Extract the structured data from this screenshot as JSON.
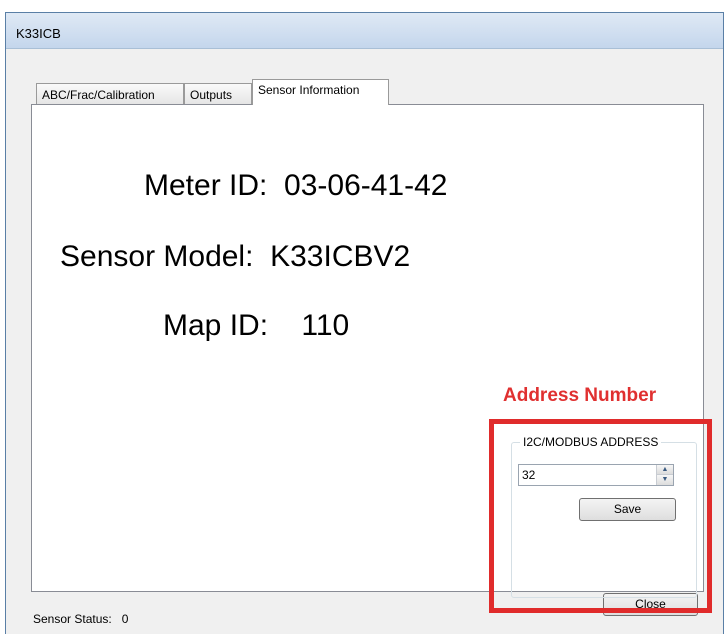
{
  "window": {
    "title": "K33ICB"
  },
  "tabs": [
    {
      "label": "ABC/Frac/Calibration",
      "active": false
    },
    {
      "label": "Outputs",
      "active": false
    },
    {
      "label": "Sensor Information",
      "active": true
    }
  ],
  "sensor_info": {
    "meter_id_label": "Meter ID:",
    "meter_id_value": "03-06-41-42",
    "sensor_model_label": "Sensor Model:",
    "sensor_model_value": "K33ICBV2",
    "map_id_label": "Map ID:",
    "map_id_value": "110"
  },
  "annotation": {
    "label": "Address Number",
    "color": "#e02b2b"
  },
  "address_group": {
    "legend": "I2C/MODBUS ADDRESS",
    "value": "32",
    "save_label": "Save"
  },
  "status_bar": {
    "label": "Sensor Status:",
    "value": "0"
  },
  "buttons": {
    "close_label": "Close"
  }
}
